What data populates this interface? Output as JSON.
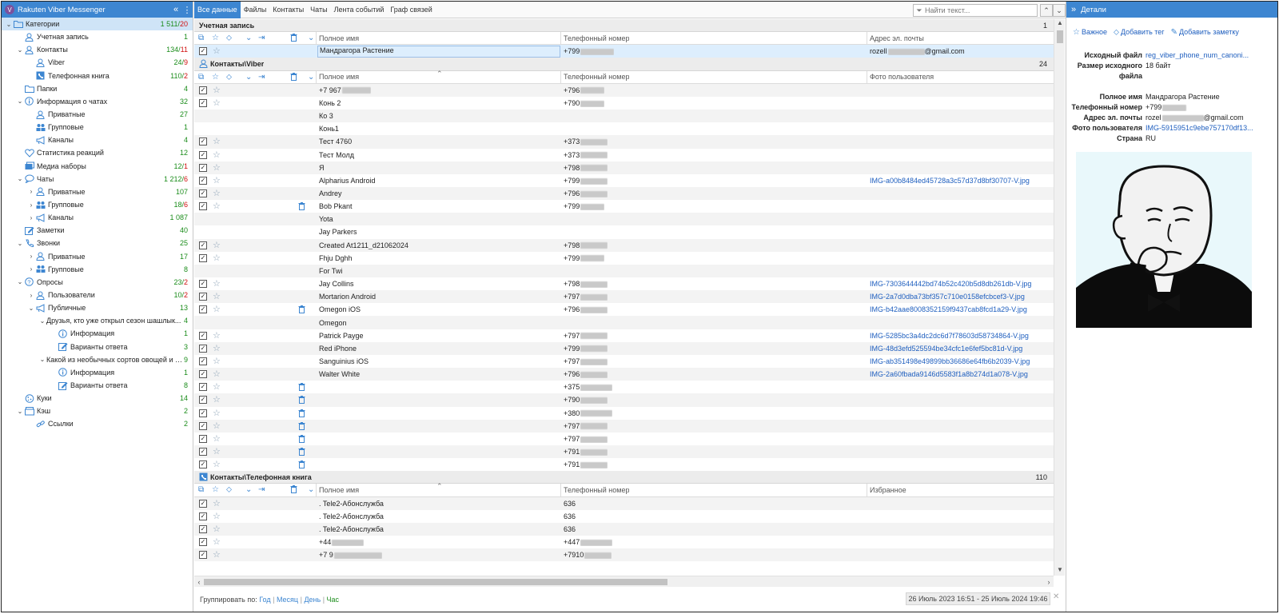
{
  "app": {
    "title": "Rakuten Viber Messenger",
    "logo_letter": "V"
  },
  "tree": [
    {
      "label": "Категории",
      "count": "1 511/",
      "count_red": "20",
      "level": 0,
      "exp": "v",
      "icon": "folder-icon",
      "selected": true
    },
    {
      "label": "Учетная запись",
      "count": "1",
      "count_red": "",
      "level": 1,
      "exp": "",
      "icon": "user-icon"
    },
    {
      "label": "Контакты",
      "count": "134/",
      "count_red": "11",
      "level": 1,
      "exp": "v",
      "icon": "user-icon"
    },
    {
      "label": "Viber",
      "count": "24/",
      "count_red": "9",
      "level": 2,
      "exp": "",
      "icon": "user-icon"
    },
    {
      "label": "Телефонная книга",
      "count": "110/",
      "count_red": "2",
      "level": 2,
      "exp": "",
      "icon": "phonebook-icon"
    },
    {
      "label": "Папки",
      "count": "4",
      "count_red": "",
      "level": 1,
      "exp": "",
      "icon": "folder-icon"
    },
    {
      "label": "Информация о чатах",
      "count": "32",
      "count_red": "",
      "level": 1,
      "exp": "v",
      "icon": "info-icon"
    },
    {
      "label": "Приватные",
      "count": "27",
      "count_red": "",
      "level": 2,
      "exp": "",
      "icon": "user-icon"
    },
    {
      "label": "Групповые",
      "count": "1",
      "count_red": "",
      "level": 2,
      "exp": "",
      "icon": "group-icon"
    },
    {
      "label": "Каналы",
      "count": "4",
      "count_red": "",
      "level": 2,
      "exp": "",
      "icon": "megaphone-icon"
    },
    {
      "label": "Статистика реакций",
      "count": "12",
      "count_red": "",
      "level": 1,
      "exp": "",
      "icon": "heart-icon"
    },
    {
      "label": "Медиа наборы",
      "count": "12/",
      "count_red": "1",
      "level": 1,
      "exp": "",
      "icon": "media-icon"
    },
    {
      "label": "Чаты",
      "count": "1 212/",
      "count_red": "6",
      "level": 1,
      "exp": "v",
      "icon": "chat-icon"
    },
    {
      "label": "Приватные",
      "count": "107",
      "count_red": "",
      "level": 2,
      "exp": ">",
      "icon": "user-icon"
    },
    {
      "label": "Групповые",
      "count": "18/",
      "count_red": "6",
      "level": 2,
      "exp": ">",
      "icon": "group-icon"
    },
    {
      "label": "Каналы",
      "count": "1 087",
      "count_red": "",
      "level": 2,
      "exp": ">",
      "icon": "megaphone-icon"
    },
    {
      "label": "Заметки",
      "count": "40",
      "count_red": "",
      "level": 1,
      "exp": "",
      "icon": "note-icon"
    },
    {
      "label": "Звонки",
      "count": "25",
      "count_red": "",
      "level": 1,
      "exp": "v",
      "icon": "phone-icon"
    },
    {
      "label": "Приватные",
      "count": "17",
      "count_red": "",
      "level": 2,
      "exp": ">",
      "icon": "user-icon"
    },
    {
      "label": "Групповые",
      "count": "8",
      "count_red": "",
      "level": 2,
      "exp": ">",
      "icon": "group-icon"
    },
    {
      "label": "Опросы",
      "count": "23/",
      "count_red": "2",
      "level": 1,
      "exp": "v",
      "icon": "question-icon"
    },
    {
      "label": "Пользователи",
      "count": "10/",
      "count_red": "2",
      "level": 2,
      "exp": ">",
      "icon": "user-icon"
    },
    {
      "label": "Публичные",
      "count": "13",
      "count_red": "",
      "level": 2,
      "exp": "v",
      "icon": "megaphone-icon"
    },
    {
      "label": "Друзья, кто уже открыл сезон шашлык...",
      "count": "4",
      "count_red": "",
      "level": 3,
      "exp": "v",
      "icon": ""
    },
    {
      "label": "Информация",
      "count": "1",
      "count_red": "",
      "level": 4,
      "exp": "",
      "icon": "info-icon"
    },
    {
      "label": "Варианты ответа",
      "count": "3",
      "count_red": "",
      "level": 4,
      "exp": "",
      "icon": "note-icon"
    },
    {
      "label": "Какой из необычных сортов овощей и ф...",
      "count": "9",
      "count_red": "",
      "level": 3,
      "exp": "v",
      "icon": ""
    },
    {
      "label": "Информация",
      "count": "1",
      "count_red": "",
      "level": 4,
      "exp": "",
      "icon": "info-icon"
    },
    {
      "label": "Варианты ответа",
      "count": "8",
      "count_red": "",
      "level": 4,
      "exp": "",
      "icon": "note-icon"
    },
    {
      "label": "Куки",
      "count": "14",
      "count_red": "",
      "level": 1,
      "exp": "",
      "icon": "cookie-icon"
    },
    {
      "label": "Кэш",
      "count": "2",
      "count_red": "",
      "level": 1,
      "exp": "v",
      "icon": "cache-icon"
    },
    {
      "label": "Ссылки",
      "count": "2",
      "count_red": "",
      "level": 2,
      "exp": "",
      "icon": "link-icon"
    }
  ],
  "tabs": [
    "Все данные",
    "Файлы",
    "Контакты",
    "Чаты",
    "Лента событий",
    "Граф связей"
  ],
  "search": {
    "placeholder": "Найти текст..."
  },
  "groups": [
    {
      "title": "Учетная запись",
      "count": "1",
      "icon": "",
      "columns": [
        "Полное имя",
        "Телефонный номер",
        "Адрес эл. почты"
      ],
      "rows": [
        {
          "name": "Мандрагора Растение",
          "phone": "+799",
          "blur": 42,
          "third": "rozell",
          "third2": "@gmail.com",
          "chk": true,
          "trash": false,
          "sel": true
        }
      ]
    },
    {
      "title": "Контакты\\Viber",
      "count": "24",
      "icon": "user-icon",
      "columns": [
        "Полное имя",
        "Телефонный номер",
        "Фото пользователя"
      ],
      "rows": [
        {
          "name": "+7 967",
          "name_blur": 36,
          "phone": "+796",
          "blur": 30,
          "third": "",
          "chk": true,
          "trash": false
        },
        {
          "name": "Конь 2",
          "phone": "+790",
          "blur": 30,
          "third": "",
          "chk": true,
          "trash": false
        },
        {
          "name": "Ко 3",
          "phone": "",
          "blur": 0,
          "third": "",
          "chk": false,
          "trash": false
        },
        {
          "name": "Конь1",
          "phone": "",
          "blur": 0,
          "third": "",
          "chk": false,
          "trash": false
        },
        {
          "name": "Тест 4760",
          "phone": "+373",
          "blur": 34,
          "third": "",
          "chk": true,
          "trash": false
        },
        {
          "name": "Тест Молд",
          "phone": "+373",
          "blur": 34,
          "third": "",
          "chk": true,
          "trash": false
        },
        {
          "name": "Я",
          "phone": "+798",
          "blur": 34,
          "third": "",
          "chk": true,
          "trash": false
        },
        {
          "name": "Alpharius Android",
          "phone": "+799",
          "blur": 34,
          "third": "IMG-a00b8484ed45728a3c57d37d8bf30707-V.jpg",
          "chk": true,
          "trash": false
        },
        {
          "name": "Andrey",
          "phone": "+796",
          "blur": 34,
          "third": "",
          "chk": true,
          "trash": false
        },
        {
          "name": "Bob Pkant",
          "phone": "+799",
          "blur": 30,
          "third": "",
          "chk": true,
          "trash": true
        },
        {
          "name": "Yota",
          "phone": "",
          "blur": 0,
          "third": "",
          "chk": false,
          "trash": false
        },
        {
          "name": "Jay Parkers",
          "phone": "",
          "blur": 0,
          "third": "",
          "chk": false,
          "trash": false
        },
        {
          "name": "Created At1211_d21062024",
          "phone": "+798",
          "blur": 34,
          "third": "",
          "chk": true,
          "trash": false
        },
        {
          "name": "Fhju Dghh",
          "phone": "+799",
          "blur": 30,
          "third": "",
          "chk": true,
          "trash": false
        },
        {
          "name": "For Twi",
          "phone": "",
          "blur": 0,
          "third": "",
          "chk": false,
          "trash": false
        },
        {
          "name": "Jay Collins",
          "phone": "+798",
          "blur": 34,
          "third": "IMG-7303644442bd74b52c420b5d8db261db-V.jpg",
          "chk": true,
          "trash": false
        },
        {
          "name": "Mortarion Android",
          "phone": "+797",
          "blur": 34,
          "third": "IMG-2a7d0dba73bf357c710e0158efcbcef3-V.jpg",
          "chk": true,
          "trash": false
        },
        {
          "name": "Omegon iOS",
          "phone": "+796",
          "blur": 34,
          "third": "IMG-b42aae8008352159f9437cab8fcd1a29-V.jpg",
          "chk": true,
          "trash": true
        },
        {
          "name": "Omegon",
          "phone": "",
          "blur": 0,
          "third": "",
          "chk": false,
          "trash": false
        },
        {
          "name": "Patrick Payge",
          "phone": "+797",
          "blur": 34,
          "third": "IMG-5285bc3a4dc2dc6d7f78603d58734864-V.jpg",
          "chk": true,
          "trash": false
        },
        {
          "name": "Red iPhone",
          "phone": "+799",
          "blur": 34,
          "third": "IMG-48d3efd525594be34cfc1e6fef5bc81d-V.jpg",
          "chk": true,
          "trash": false
        },
        {
          "name": "Sanguinius iOS",
          "phone": "+797",
          "blur": 34,
          "third": "IMG-ab351498e49899bb36686e64fb6b2039-V.jpg",
          "chk": true,
          "trash": false
        },
        {
          "name": "Walter White",
          "phone": "+796",
          "blur": 34,
          "third": "IMG-2a60fbada9146d5583f1a8b274d1a078-V.jpg",
          "chk": true,
          "trash": false
        },
        {
          "name": "",
          "phone": "+375",
          "blur": 40,
          "third": "",
          "chk": true,
          "trash": true
        },
        {
          "name": "",
          "phone": "+790",
          "blur": 34,
          "third": "",
          "chk": true,
          "trash": true
        },
        {
          "name": "",
          "phone": "+380",
          "blur": 40,
          "third": "",
          "chk": true,
          "trash": true
        },
        {
          "name": "",
          "phone": "+797",
          "blur": 34,
          "third": "",
          "chk": true,
          "trash": true
        },
        {
          "name": "",
          "phone": "+797",
          "blur": 34,
          "third": "",
          "chk": true,
          "trash": true
        },
        {
          "name": "",
          "phone": "+791",
          "blur": 34,
          "third": "",
          "chk": true,
          "trash": true
        },
        {
          "name": "",
          "phone": "+791",
          "blur": 34,
          "third": "",
          "chk": true,
          "trash": true
        }
      ]
    },
    {
      "title": "Контакты\\Телефонная книга",
      "count": "110",
      "icon": "phonebook-icon",
      "columns": [
        "Полное имя",
        "Телефонный номер",
        "Избранное"
      ],
      "rows": [
        {
          "name": ". Tele2-Абонслужба",
          "phone": "636",
          "blur": 0,
          "third": "",
          "chk": true,
          "trash": false
        },
        {
          "name": ". Tele2-Абонслужба",
          "phone": "636",
          "blur": 0,
          "third": "",
          "chk": true,
          "trash": false
        },
        {
          "name": ". Tele2-Абонслужба",
          "phone": "636",
          "blur": 0,
          "third": "",
          "chk": true,
          "trash": false
        },
        {
          "name": "+44",
          "name_blur": 40,
          "phone": "+447",
          "blur": 40,
          "third": "",
          "chk": true,
          "trash": false
        },
        {
          "name": "+7 9",
          "name_blur": 60,
          "phone": "+7910",
          "blur": 34,
          "third": "",
          "chk": true,
          "trash": false
        }
      ]
    }
  ],
  "status": {
    "group_by_label": "Группировать по:",
    "group_by_options": [
      "Год",
      "Месяц",
      "День",
      "Час"
    ],
    "date_range": "26 Июль 2023 16:51 - 25 Июль 2024 19:46"
  },
  "details": {
    "title": "Детали",
    "actions": [
      "Важное",
      "Добавить тег",
      "Добавить заметку"
    ],
    "props": [
      {
        "k": "Исходный файл",
        "v": "reg_viber_phone_num_canoni...",
        "link": true
      },
      {
        "k": "Размер исходного",
        "v": "18 байт",
        "link": false
      },
      {
        "k": "файла",
        "v": "",
        "link": false
      },
      {
        "k": "",
        "v": "",
        "link": false
      },
      {
        "k": "Полное имя",
        "v": "Мандрагора Растение",
        "link": false
      },
      {
        "k": "Телефонный номер",
        "v": "+799",
        "link": false,
        "blur": true
      },
      {
        "k": "Адрес эл. почты",
        "v": "rozel",
        "v2": "@gmail.com",
        "link": false,
        "blur": true
      },
      {
        "k": "Фото пользователя",
        "v": "IMG-5915951c9ebe757170df13...",
        "link": true
      },
      {
        "k": "Страна",
        "v": "RU",
        "link": false
      }
    ]
  },
  "colors": {
    "accent": "#3d86d1",
    "count_green": "#1a8c1a",
    "count_red": "#d01010",
    "link": "#1f5fbf",
    "selection": "#ddeefd"
  }
}
